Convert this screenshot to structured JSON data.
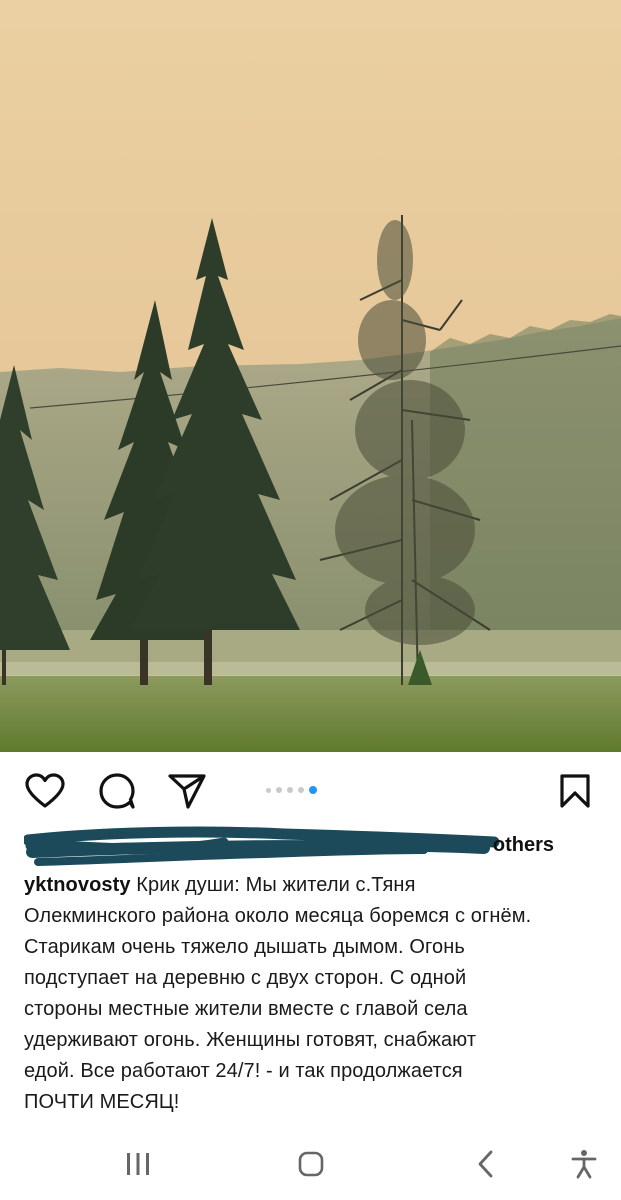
{
  "post": {
    "likes_text": "others",
    "username": "yktnovosty",
    "caption_lines": [
      "Крик души: Мы жители с.Тяня",
      "Олекминского района около месяца боремся с огнём.",
      "Старикам очень тяжело дышать дымом. Огонь",
      "подступает на деревню с двух сторон. С одной",
      "стороны местные жители вместе с главой села",
      "удерживают огонь. Женщины готовят, снабжают",
      "едой. Все работают 24/7! - и так продолжается",
      "ПОЧТИ МЕСЯЦ!"
    ],
    "carousel": {
      "count": 5,
      "active_index": 4
    }
  },
  "icons": {
    "like": "heart-icon",
    "comment": "comment-bubble-icon",
    "share": "paper-plane-icon",
    "save": "bookmark-icon",
    "nav_recents": "recent-apps-icon",
    "nav_home": "home-icon",
    "nav_back": "back-chevron-icon",
    "nav_accessibility": "accessibility-icon"
  },
  "colors": {
    "carousel_active": "#2196f3",
    "carousel_inactive": "#c9c9c9",
    "redaction": "#1d4a5a",
    "sky": "#e8c99a",
    "grass": "#6f8a3a"
  }
}
